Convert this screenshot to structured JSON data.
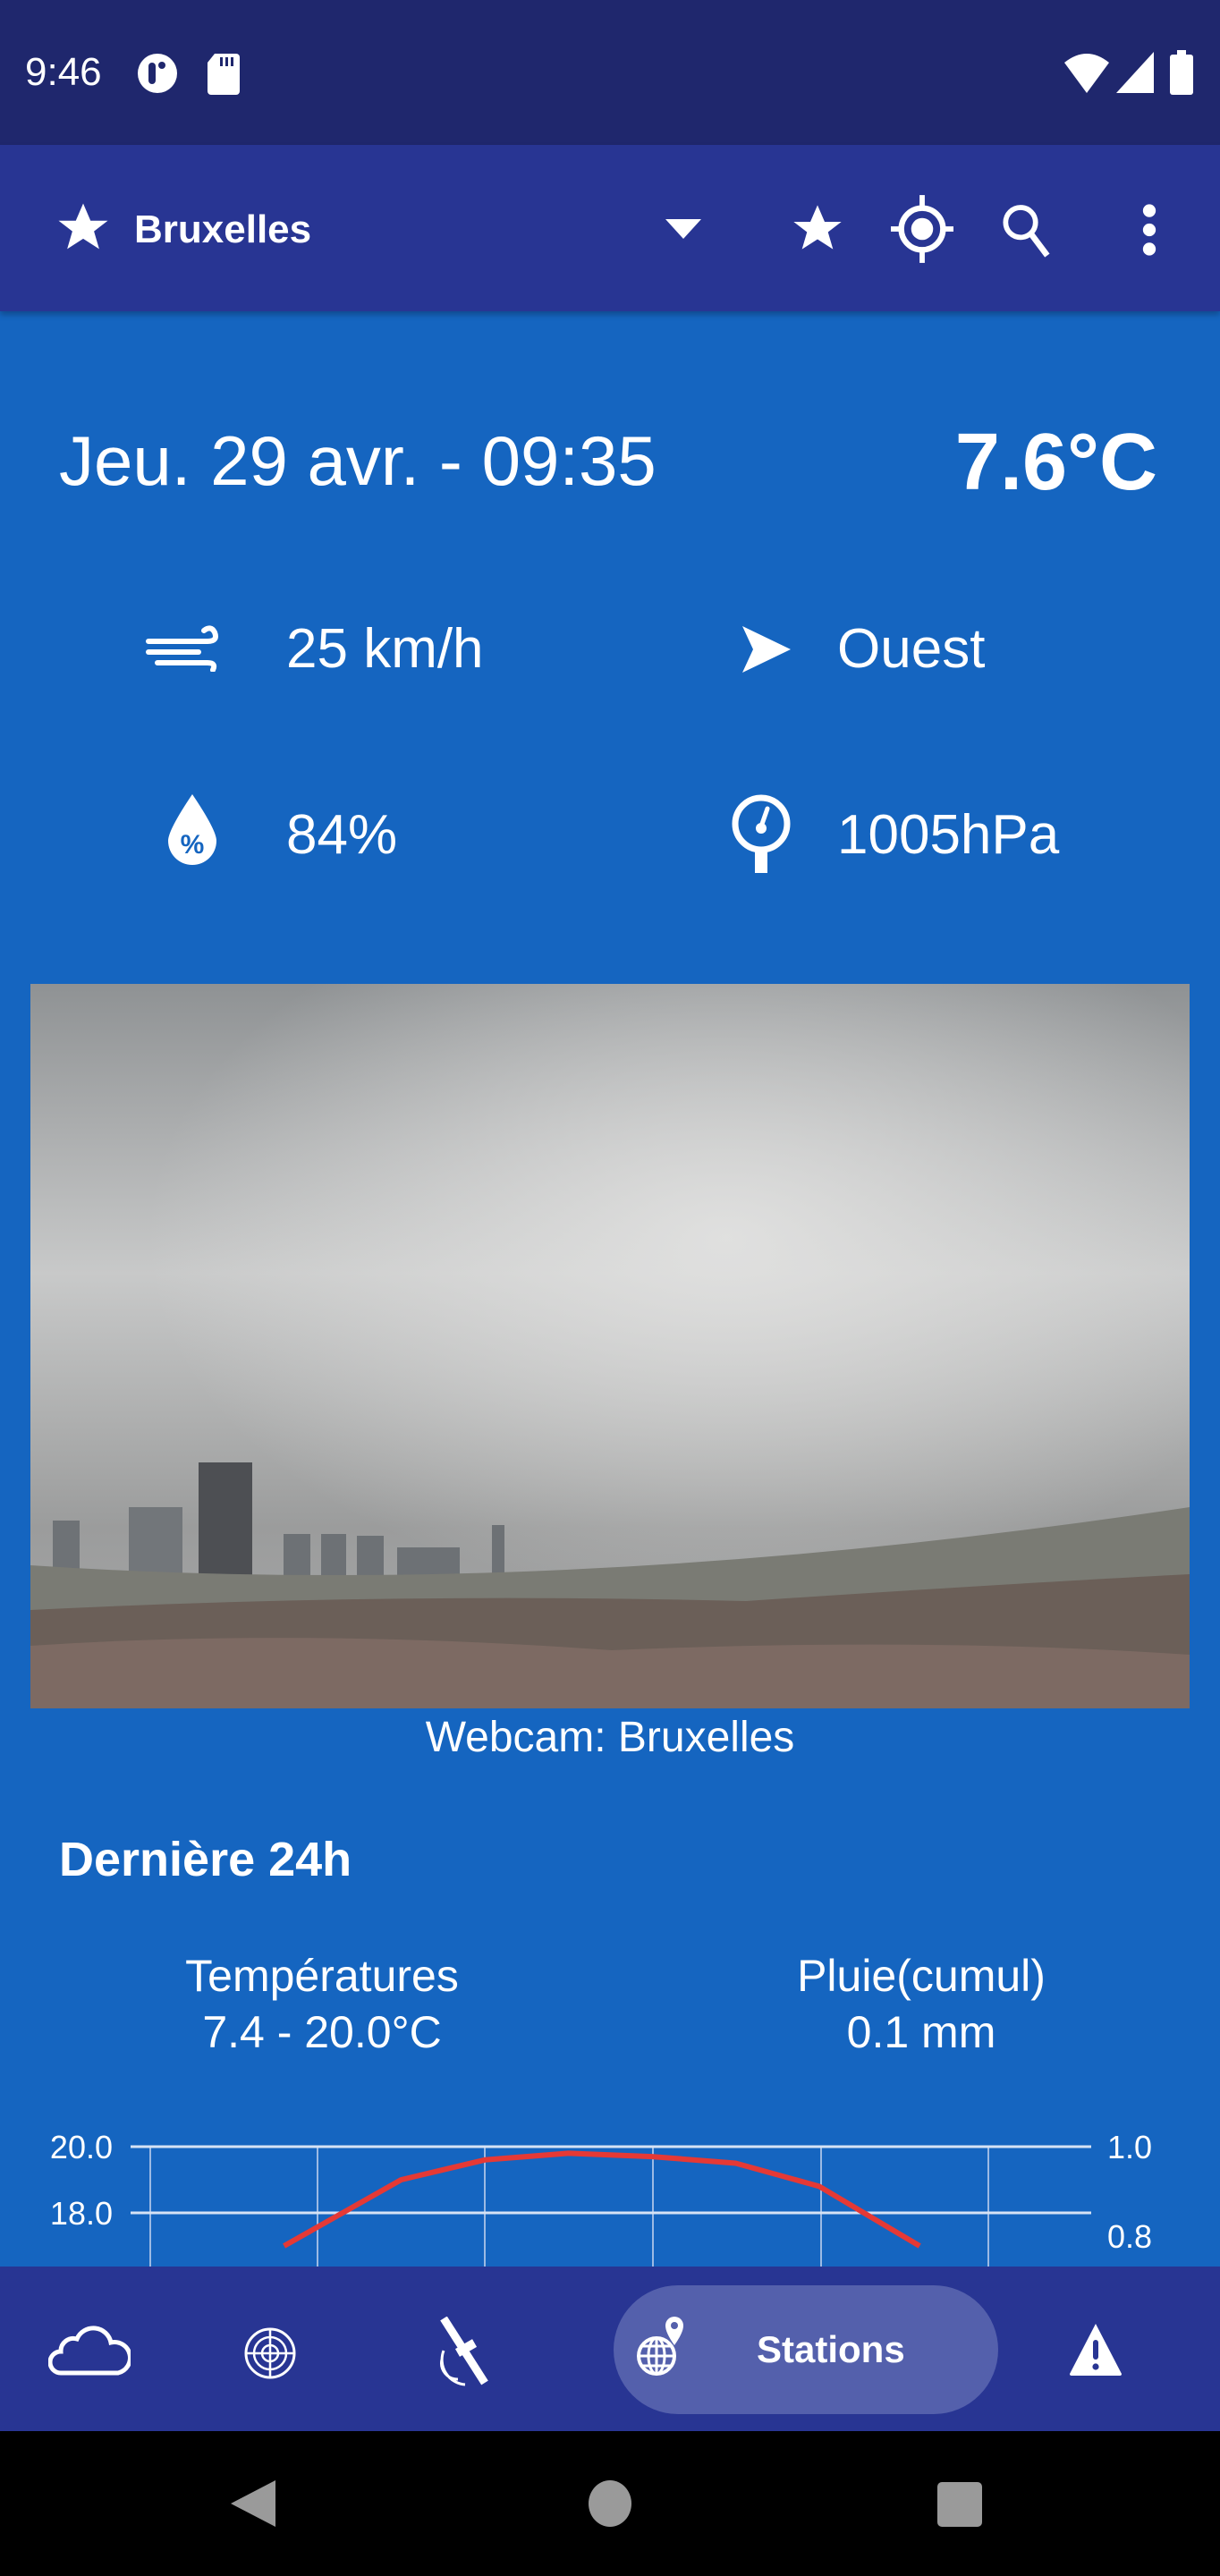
{
  "status_bar": {
    "time": "9:46",
    "left_icons": [
      "app-notification-icon",
      "sd-card-icon"
    ],
    "right_icons": [
      "wifi-icon",
      "cell-signal-icon",
      "battery-icon"
    ]
  },
  "app_bar": {
    "location": "Bruxelles",
    "actions": [
      "favorite-star-icon",
      "my-location-icon",
      "search-icon",
      "more-vert-icon"
    ]
  },
  "current": {
    "datetime": "Jeu. 29 avr. - 09:35",
    "temperature": "7.6°C",
    "wind_speed": "25 km/h",
    "wind_direction": "Ouest",
    "humidity": "84%",
    "pressure": "1005hPa"
  },
  "webcam": {
    "caption": "Webcam: Bruxelles"
  },
  "last24": {
    "title": "Dernière 24h",
    "temps_label": "Températures",
    "temps_value": "7.4 - 20.0°C",
    "rain_label": "Pluie(cumul)",
    "rain_value": "0.1 mm"
  },
  "chart_data": {
    "type": "line",
    "title": "",
    "left_axis_ticks": [
      "20.0",
      "18.0"
    ],
    "right_axis_ticks": [
      "1.0",
      "0.8"
    ],
    "series": [
      {
        "name": "Température",
        "color": "#E53935",
        "x": [
          0.8,
          1.5,
          2,
          2.5,
          3,
          3.5,
          4,
          4.6
        ],
        "values": [
          17.0,
          19.0,
          19.6,
          19.8,
          19.7,
          19.5,
          18.8,
          17.0
        ]
      }
    ],
    "ylim": [
      17.0,
      20.5
    ],
    "grid": true
  },
  "bottom_nav": {
    "items": [
      {
        "icon": "cloud-icon",
        "label": ""
      },
      {
        "icon": "radar-icon",
        "label": ""
      },
      {
        "icon": "satellite-icon",
        "label": ""
      },
      {
        "icon": "globe-pin-icon",
        "label": "Stations",
        "active": true
      },
      {
        "icon": "warning-icon",
        "label": ""
      }
    ]
  }
}
